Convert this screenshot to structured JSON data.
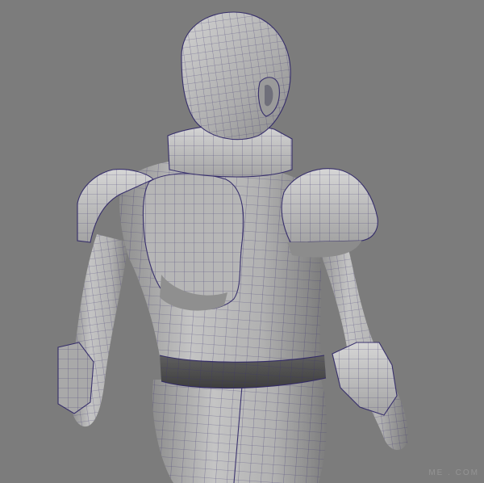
{
  "viewport": {
    "background_color": "#7c7c7c",
    "mesh_color": "#b8b8b8",
    "wireframe_color": "#3a3170",
    "subject": "character-model-back-view"
  },
  "watermark": {
    "text": "ME . COM"
  }
}
